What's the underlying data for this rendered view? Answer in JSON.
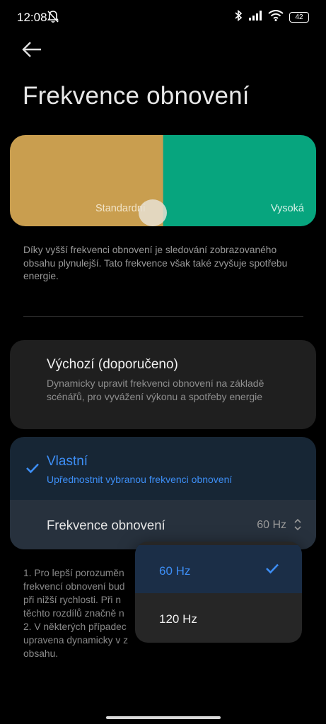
{
  "status_bar": {
    "time": "12:08",
    "battery": "42",
    "icons": [
      "bell-off-icon",
      "bluetooth-icon",
      "signal-icon",
      "wifi-icon",
      "battery-icon"
    ]
  },
  "header": {
    "title": "Frekvence obnovení",
    "back_icon": "arrow-left-icon"
  },
  "preview": {
    "left_label": "Standardní",
    "right_label": "Vysoká",
    "left_color": "#c99e4f",
    "right_color": "#07a57e"
  },
  "description": "Díky vyšší frekvenci obnovení je sledování zobrazovaného obsahu plynulejší. Tato frekvence však také zvyšuje spotřebu energie.",
  "options": {
    "default": {
      "title": "Výchozí (doporučeno)",
      "subtitle": "Dynamicky upravit frekvenci obnovení na základě scénářů, pro vyvážení výkonu a spotřeby energie"
    },
    "custom": {
      "title": "Vlastní",
      "subtitle": "Upřednostnit vybranou frekvenci obnovení",
      "selected": true,
      "row_label": "Frekvence obnovení",
      "row_value": "60 Hz"
    }
  },
  "notes": [
    "1. Pro lepší porozuměn",
    "frekvencí obnovení bud",
    "při nižší rychlosti. Při n",
    "těchto rozdílů značně n",
    "2. V některých případec",
    "upravena dynamicky v z",
    "obsahu."
  ],
  "dropdown": {
    "items": [
      {
        "label": "60 Hz",
        "selected": true
      },
      {
        "label": "120 Hz",
        "selected": false
      }
    ]
  },
  "accent_color": "#3d8ef5"
}
